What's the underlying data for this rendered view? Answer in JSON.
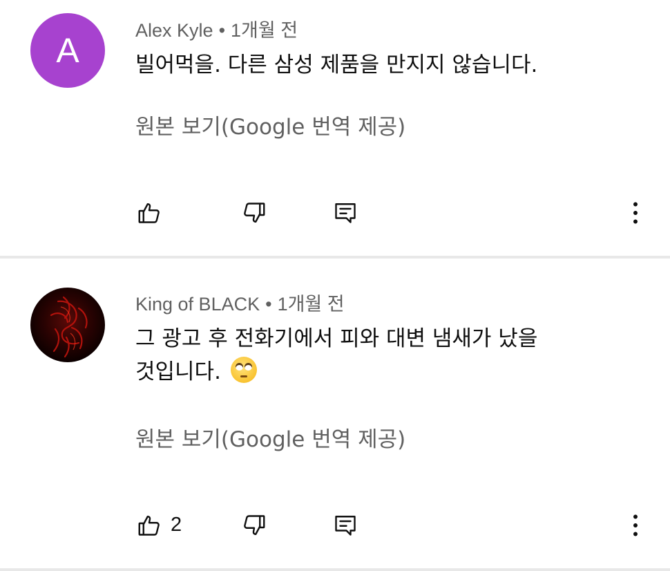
{
  "colors": {
    "avatar_a": "#a742cf",
    "secondary_text": "#606060",
    "primary_text": "#0f0f0f",
    "separator": "#e8e8e8"
  },
  "comments": [
    {
      "author": "Alex Kyle",
      "separator": "•",
      "time": "1개월 전",
      "avatar_letter": "A",
      "text_lines": [
        "빌어먹을. 다른 삼성 제품을 만지지 않습니다."
      ],
      "translate_label": "원본 보기(Google 번역 제공)",
      "like_count": "",
      "icons": {
        "like": "thumbs-up-icon",
        "dislike": "thumbs-down-icon",
        "reply": "reply-comment-icon",
        "more": "more-vertical-icon"
      }
    },
    {
      "author": "King of BLACK",
      "separator": "•",
      "time": "1개월 전",
      "avatar_letter": "",
      "text_lines": [
        "그 광고 후 전화기에서 피와 대변 냄새가 났을",
        "것입니다."
      ],
      "emoji": "face-with-rolling-eyes",
      "translate_label": "원본 보기(Google 번역 제공)",
      "like_count": "2",
      "icons": {
        "like": "thumbs-up-icon",
        "dislike": "thumbs-down-icon",
        "reply": "reply-comment-icon",
        "more": "more-vertical-icon"
      }
    }
  ]
}
